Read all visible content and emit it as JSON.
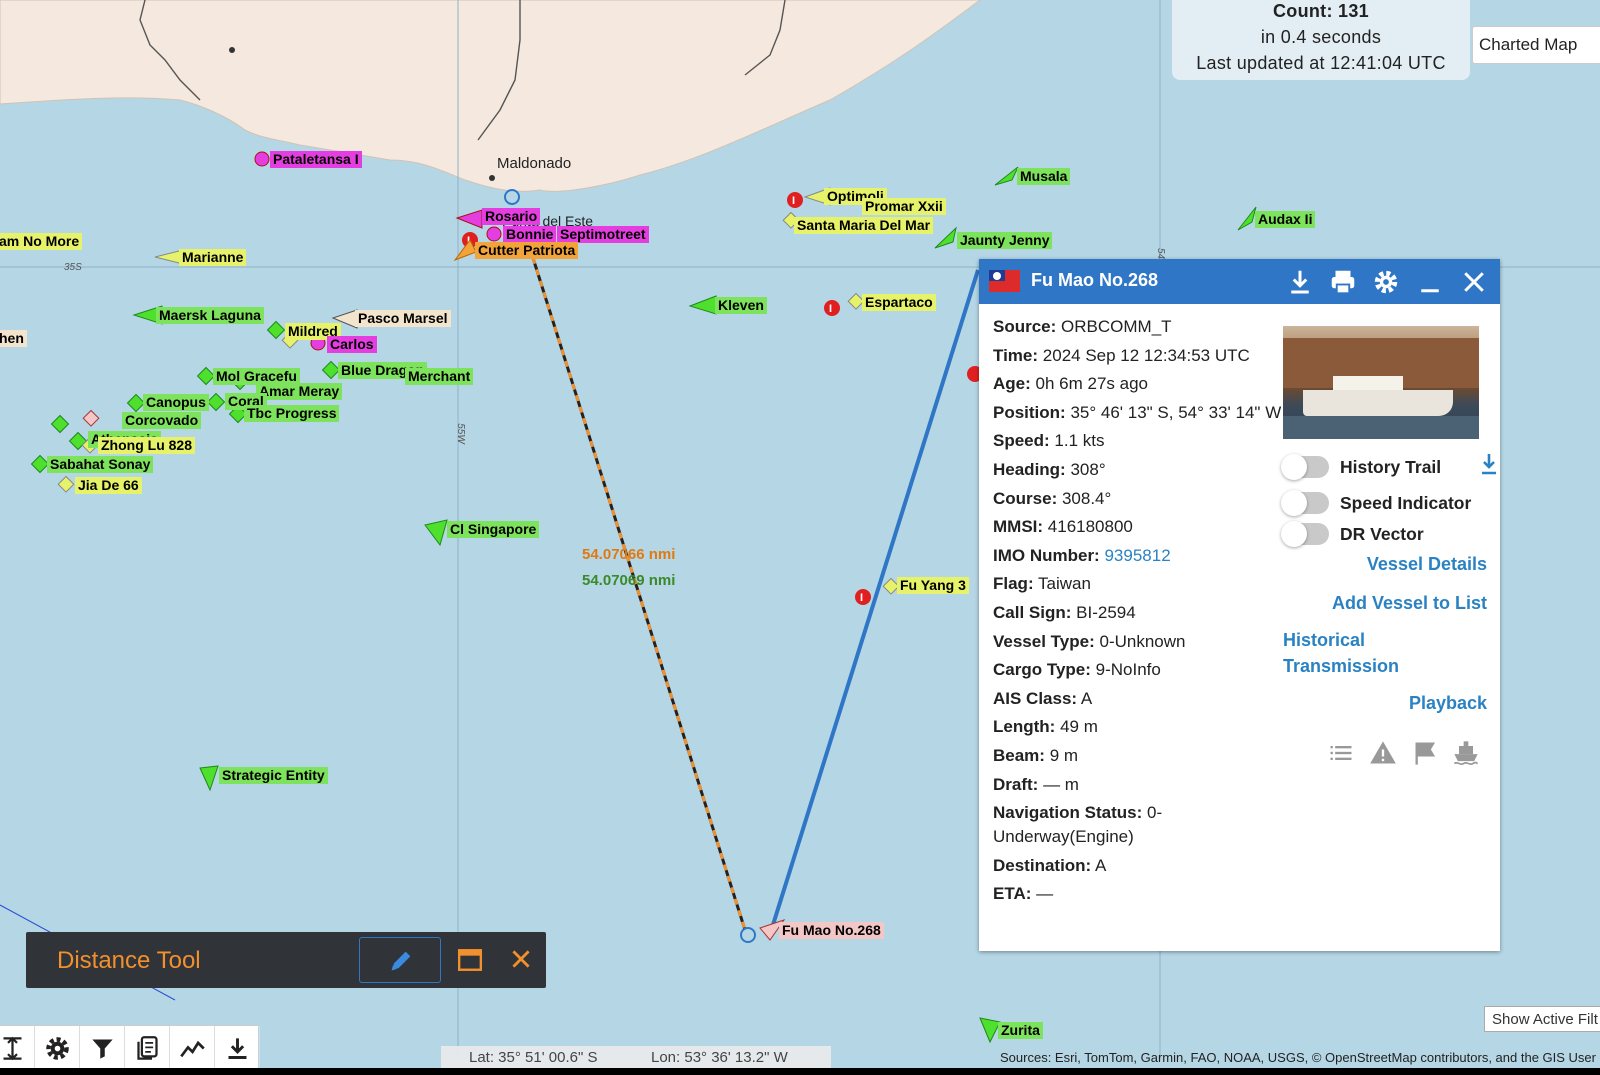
{
  "map": {
    "places": [
      {
        "name": "Maldonado"
      },
      {
        "name": "Punta del Este"
      }
    ],
    "grid_labels": [
      "35S",
      "55W",
      "54"
    ],
    "vessels": [
      {
        "name": "Pataletansa I",
        "style": "magenta"
      },
      {
        "name": "am No More",
        "style": "yellow"
      },
      {
        "name": "Marianne",
        "style": "yellow"
      },
      {
        "name": "Maersk Laguna",
        "style": "green"
      },
      {
        "name": "Pasco Marsel",
        "style": "tan"
      },
      {
        "name": "Mildred",
        "style": "yellow"
      },
      {
        "name": "Carlos",
        "style": "magenta"
      },
      {
        "name": "hen",
        "style": "tan"
      },
      {
        "name": "Blue Dragon",
        "style": "green"
      },
      {
        "name": "Mol Gracefu",
        "style": "green"
      },
      {
        "name": "Merchant",
        "style": "green"
      },
      {
        "name": "Amar Meray",
        "style": "green"
      },
      {
        "name": "Canopus",
        "style": "green"
      },
      {
        "name": "Coral",
        "style": "green"
      },
      {
        "name": "Corcovado",
        "style": "green"
      },
      {
        "name": "Tbc Progress",
        "style": "green"
      },
      {
        "name": "Athenasia",
        "style": "green"
      },
      {
        "name": "Zhong Lu 828",
        "style": "yellow"
      },
      {
        "name": "Sabahat Sonay",
        "style": "green"
      },
      {
        "name": "Jia De 66",
        "style": "yellow"
      },
      {
        "name": "Rosario",
        "style": "magenta"
      },
      {
        "name": "Bonnie",
        "style": "magenta"
      },
      {
        "name": "Septimotreet",
        "style": "magenta"
      },
      {
        "name": "Cutter Patriota",
        "style": "orange"
      },
      {
        "name": "Optimoli",
        "style": "yellow"
      },
      {
        "name": "Promar Xxii",
        "style": "yellow"
      },
      {
        "name": "Santa Maria Del Mar",
        "style": "yellow"
      },
      {
        "name": "Musala",
        "style": "green"
      },
      {
        "name": "Jaunty Jenny",
        "style": "green"
      },
      {
        "name": "Audax Ii",
        "style": "green"
      },
      {
        "name": "Kleven",
        "style": "green"
      },
      {
        "name": "Espartaco",
        "style": "yellow"
      },
      {
        "name": "Cl Singapore",
        "style": "green"
      },
      {
        "name": "Fu Yang 3",
        "style": "yellow"
      },
      {
        "name": "Strategic Entity",
        "style": "green"
      },
      {
        "name": "Fu Mao No.268",
        "style": "pink"
      },
      {
        "name": "Zurita",
        "style": "green"
      }
    ],
    "distance_labels": {
      "orange": "54.07066 nmi",
      "green": "54.07069 nmi"
    }
  },
  "stats": {
    "count": "Count: 131",
    "time": "in 0.4 seconds",
    "updated": "Last updated at 12:41:04 UTC"
  },
  "basemap": {
    "selected": "Charted Map"
  },
  "panel": {
    "title": "Fu Mao No.268",
    "fields": [
      {
        "label": "Source:",
        "value": "ORBCOMM_T"
      },
      {
        "label": "Time:",
        "value": "2024 Sep 12 12:34:53 UTC"
      },
      {
        "label": "Age:",
        "value": "0h 6m 27s ago"
      },
      {
        "label": "Position:",
        "value": " 35° 46' 13\" S, 54° 33' 14\" W"
      },
      {
        "label": "Speed:",
        "value": "1.1 kts"
      },
      {
        "label": "Heading:",
        "value": "308°"
      },
      {
        "label": "Course:",
        "value": "308.4°"
      },
      {
        "label": "MMSI:",
        "value": "416180800"
      },
      {
        "label": "IMO Number:",
        "value": "9395812",
        "link": true
      },
      {
        "label": "Flag:",
        "value": "Taiwan"
      },
      {
        "label": "Call Sign:",
        "value": "BI-2594"
      },
      {
        "label": "Vessel Type:",
        "value": "0-Unknown"
      },
      {
        "label": "Cargo Type:",
        "value": "9-NoInfo"
      },
      {
        "label": "AIS Class:",
        "value": "A"
      },
      {
        "label": "Length:",
        "value": "49 m"
      },
      {
        "label": "Beam:",
        "value": "9 m"
      },
      {
        "label": "Draft:",
        "value": "— m"
      },
      {
        "label": "Navigation Status:",
        "value": "0-Underway(Engine)"
      },
      {
        "label": "Destination:",
        "value": "A"
      },
      {
        "label": "ETA:",
        "value": "—"
      }
    ],
    "toggles": [
      {
        "label": "History Trail",
        "on": false
      },
      {
        "label": "Speed Indicator",
        "on": false
      },
      {
        "label": "DR Vector",
        "on": false
      }
    ],
    "links": {
      "vessel_details": "Vessel Details",
      "add_to_list": "Add Vessel to List",
      "historical": "Historical Transmission",
      "playback": "Playback"
    },
    "tool_icons": [
      "list-icon",
      "warning-icon",
      "flag-icon",
      "ship-icon"
    ]
  },
  "distance_tool": {
    "title": "Distance Tool"
  },
  "toolbar": {
    "icons": [
      "expand-vertical-icon",
      "gear-icon",
      "filter-icon",
      "layers-icon",
      "chart-line-icon",
      "download-icon"
    ]
  },
  "coords": {
    "lat": "Lat: 35° 51' 00.6\" S",
    "lon": "Lon: 53° 36' 13.2\" W"
  },
  "attribution": "Sources: Esri, TomTom, Garmin, FAO, NOAA, USGS, © OpenStreetMap contributors, and the GIS User Co",
  "filters_button": "Show Active Filt",
  "colors": {
    "header": "#2f77c6",
    "link": "#2a82c3",
    "distance_orange": "#f2902e",
    "water": "#b5d6e5",
    "land": "#f5e9df"
  }
}
